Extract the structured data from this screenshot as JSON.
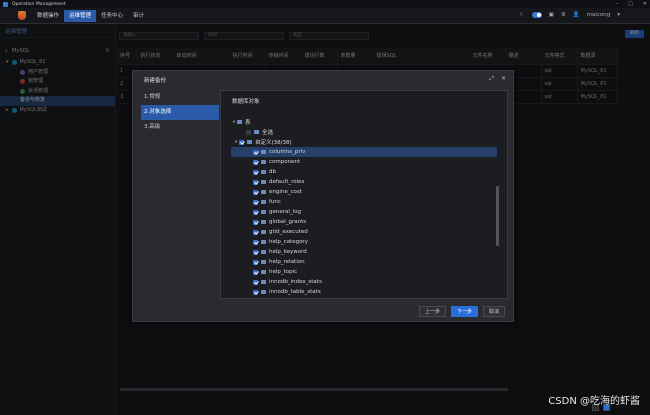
{
  "window": {
    "title": "Operation Management"
  },
  "menu": {
    "items": [
      "数据操作",
      "运维管理",
      "任务中心",
      "审计"
    ],
    "active_index": 1
  },
  "topbar": {
    "user": "maicong"
  },
  "sidebar": {
    "header": "运维管理",
    "search_value": "MySQL",
    "tree": [
      {
        "label": "MySQL_81",
        "level": 0,
        "caret": "▾",
        "dot": "#1da4e0"
      },
      {
        "label": "用户管理",
        "level": 1,
        "dot": "#8a6cd0"
      },
      {
        "label": "锁管理",
        "level": 1,
        "dot": "#e05050"
      },
      {
        "label": "会话管理",
        "level": 1,
        "dot": "#40b060"
      },
      {
        "label": "备份与恢复",
        "level": 1,
        "dot": "",
        "selected": true
      },
      {
        "label": "MySQL测试",
        "level": 0,
        "caret": "▸",
        "dot": "#1da4e0"
      }
    ]
  },
  "filters": {
    "name_placeholder": "请输入",
    "time_label": "时间",
    "type_label": "类型",
    "search_button": "刷新"
  },
  "table": {
    "columns": [
      "序号",
      "执行状态",
      "启动时间",
      "执行时间",
      "传输时间",
      "成功行数",
      "表数量",
      "错误SQL",
      "文件名称",
      "描述",
      "文件格式",
      "数据源"
    ],
    "rows": [
      [
        "1",
        "",
        "",
        "",
        "",
        "",
        "",
        "",
        "",
        "",
        "sql",
        "MySQL_81"
      ],
      [
        "2",
        "",
        "",
        "",
        "",
        "",
        "",
        "",
        "",
        "",
        "sql",
        "MySQL_81"
      ],
      [
        "3",
        "",
        "",
        "",
        "",
        "",
        "",
        "",
        "",
        "",
        "sql",
        "MySQL_81"
      ]
    ]
  },
  "dialog": {
    "title": "新建备份",
    "steps": [
      "1.常规",
      "2.对象选择",
      "3.高级"
    ],
    "active_step": 1,
    "panel_title": "数据库对象",
    "tree_root": "表",
    "all_label": "全选",
    "custom_label": "自定义(38/38)",
    "tables": [
      "columns_priv",
      "component",
      "db",
      "default_roles",
      "engine_cost",
      "func",
      "general_log",
      "global_grants",
      "gtid_executed",
      "help_category",
      "help_keyword",
      "help_relation",
      "help_topic",
      "innodb_index_stats",
      "innodb_table_stats"
    ],
    "highlighted_index": 0,
    "buttons": {
      "prev": "上一步",
      "next": "下一步",
      "cancel": "取消"
    }
  },
  "watermark": "CSDN @吃海的虾酱"
}
